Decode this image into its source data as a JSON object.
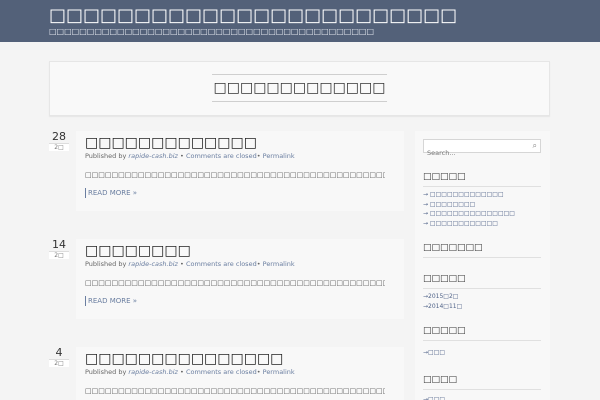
{
  "site": {
    "title": "□□□□□□□□□□□□□□□□□□□□□□□□",
    "description": "□□□□□□□□□□□□□□□□□□□□□□□□□□□□□□□□□□□□□□□□□□□"
  },
  "page_title": "□□□□□□□□□□□□□",
  "posts": [
    {
      "day": "28",
      "month": "2□",
      "title": "□□□□□□□□□□□□□",
      "author": "rapide-cash.biz",
      "comments": "Comments are closed",
      "permalink": "Permalink",
      "published_by": "Published by",
      "excerpt": "□□□□□□□□□□□□□□□□□□□□□□□□□□□□□□□□□□□□□□□□□□□□□□□□□□□□□□□□□ [...]",
      "read_more": "READ MORE »"
    },
    {
      "day": "14",
      "month": "2□",
      "title": "□□□□□□□□",
      "author": "rapide-cash.biz",
      "comments": "Comments are closed",
      "permalink": "Permalink",
      "published_by": "Published by",
      "excerpt": "□□□□□□□□□□□□□□□□□□□□□□□□□□□□□□□□□□□□□□□□□□□□□□□□□□□□□□□□□ [...]",
      "read_more": "READ MORE »"
    },
    {
      "day": "4",
      "month": "2□",
      "title": "□□□□□□□□□□□□□□□",
      "author": "rapide-cash.biz",
      "comments": "Comments are closed",
      "permalink": "Permalink",
      "published_by": "Published by",
      "excerpt": "□□□□□□□□□□□□□□□□□□□□□□□□□□□□□□□□□□□□□□□□□□□□□□□□□□□□□□□□□ [...]",
      "read_more": ""
    }
  ],
  "sidebar": {
    "search_placeholder": "Search...",
    "widgets": [
      {
        "title": "□□□□□",
        "items": [
          "→ □□□□□□□□□□□□□",
          "→ □□□□□□□□",
          "→ □□□□□□□□□□□□□□□",
          "→ □□□□□□□□□□□□"
        ]
      },
      {
        "title": "□□□□□□□",
        "items": []
      },
      {
        "title": "□□□□□",
        "items": [
          "→2015□2□",
          "→2014□11□"
        ]
      },
      {
        "title": "□□□□□",
        "items": [
          "→□□□"
        ]
      },
      {
        "title": "□□□□",
        "items": [
          "→□□□"
        ]
      }
    ]
  },
  "colors": {
    "header_bg": "#536179",
    "link": "#6a7ea0",
    "page_bg": "#f4f4f4"
  }
}
